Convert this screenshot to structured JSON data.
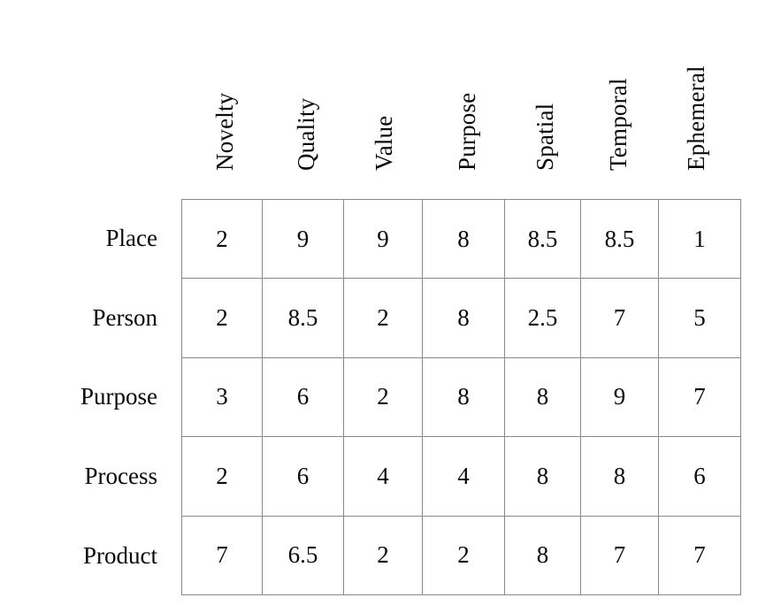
{
  "chart_data": {
    "type": "table",
    "title": "",
    "xlabel": "",
    "ylabel": "",
    "grid": true,
    "legend": "none",
    "columns": [
      "Novelty",
      "Quality",
      "Value",
      "Purpose",
      "Spatial",
      "Temporal",
      "Ephemeral"
    ],
    "categories": [
      "Place",
      "Person",
      "Purpose",
      "Process",
      "Product"
    ],
    "series": [
      {
        "name": "Place",
        "values": [
          2,
          9,
          9,
          8,
          8.5,
          8.5,
          1
        ]
      },
      {
        "name": "Person",
        "values": [
          2,
          8.5,
          2,
          8,
          2.5,
          7,
          5
        ]
      },
      {
        "name": "Purpose",
        "values": [
          3,
          6,
          2,
          8,
          8,
          9,
          7
        ]
      },
      {
        "name": "Process",
        "values": [
          2,
          6,
          4,
          4,
          8,
          8,
          6
        ]
      },
      {
        "name": "Product",
        "values": [
          7,
          6.5,
          2,
          2,
          8,
          7,
          7
        ]
      }
    ],
    "rows": [
      {
        "label": "Place",
        "cells": [
          "2",
          "9",
          "9",
          "8",
          "8.5",
          "8.5",
          "1"
        ]
      },
      {
        "label": "Person",
        "cells": [
          "2",
          "8.5",
          "2",
          "8",
          "2.5",
          "7",
          "5"
        ]
      },
      {
        "label": "Purpose",
        "cells": [
          "3",
          "6",
          "2",
          "8",
          "8",
          "9",
          "7"
        ]
      },
      {
        "label": "Process",
        "cells": [
          "2",
          "6",
          "4",
          "4",
          "8",
          "8",
          "6"
        ]
      },
      {
        "label": "Product",
        "cells": [
          "7",
          "6.5",
          "2",
          "2",
          "8",
          "7",
          "7"
        ]
      }
    ],
    "value_range": [
      1,
      9
    ],
    "colors": {
      "background": "#ffffff",
      "text": "#0a0a0a",
      "gridline": "#8a8a8a"
    }
  },
  "layout": {
    "column_edges": [
      205,
      296,
      388,
      477,
      570,
      656,
      744,
      837
    ],
    "row_edges": [
      225,
      315,
      404,
      494,
      584,
      673
    ]
  }
}
